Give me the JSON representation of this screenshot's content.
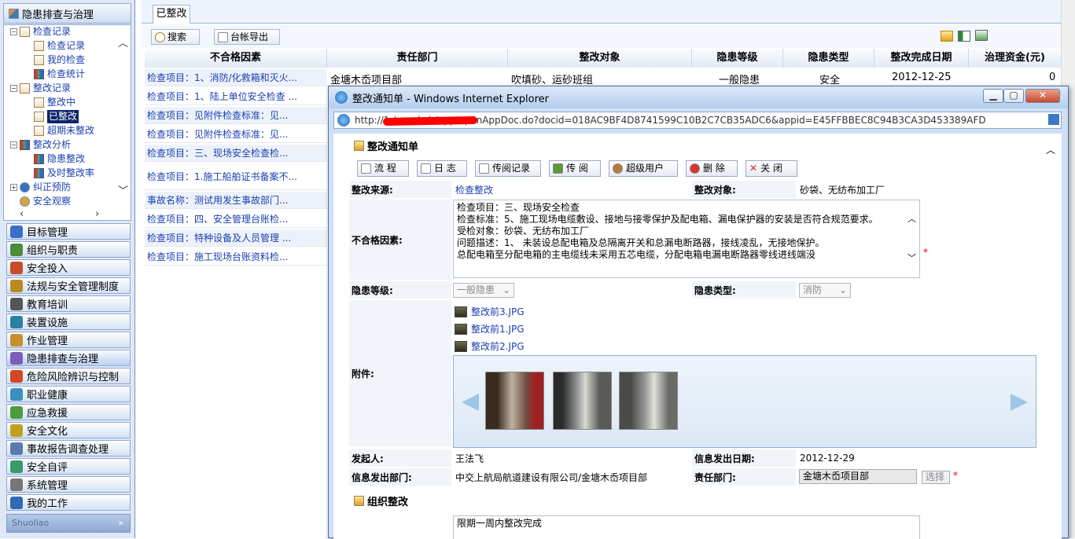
{
  "left": {
    "header": "隐患排查与治理",
    "tree": [
      {
        "label": "检查记录",
        "level": 0,
        "icon": "calendar-icon"
      },
      {
        "label": "检查记录",
        "level": 1,
        "icon": "doc-icon"
      },
      {
        "label": "我的检查",
        "level": 1,
        "icon": "doc-icon"
      },
      {
        "label": "检查统计",
        "level": 1,
        "icon": "bar-chart-icon"
      },
      {
        "label": "整改记录",
        "level": 0,
        "icon": "checklist-icon"
      },
      {
        "label": "整改中",
        "level": 1,
        "icon": "checklist-icon"
      },
      {
        "label": "已整改",
        "level": 1,
        "icon": "checklist-icon",
        "selected": true
      },
      {
        "label": "超期未整改",
        "level": 1,
        "icon": "checklist-icon"
      },
      {
        "label": "整改分析",
        "level": 0,
        "icon": "bar-chart-icon"
      },
      {
        "label": "隐患整改",
        "level": 1,
        "icon": "bar-chart-icon"
      },
      {
        "label": "及时整改率",
        "level": 1,
        "icon": "bar-chart-icon"
      },
      {
        "label": "纠正预防",
        "level": 0,
        "icon": "info-icon"
      },
      {
        "label": "安全观察",
        "level": 0,
        "icon": "user-icon"
      }
    ],
    "menus": [
      {
        "label": "目标管理",
        "color": "#3b6fc7"
      },
      {
        "label": "组织与职责",
        "color": "#4a8c3a"
      },
      {
        "label": "安全投入",
        "color": "#c94c2b"
      },
      {
        "label": "法规与安全管理制度",
        "color": "#b88a20"
      },
      {
        "label": "教育培训",
        "color": "#555555"
      },
      {
        "label": "装置设施",
        "color": "#2c7fa3"
      },
      {
        "label": "作业管理",
        "color": "#c7902b"
      },
      {
        "label": "隐患排查与治理",
        "color": "#7a5db5",
        "active": true
      },
      {
        "label": "危险风险辨识与控制",
        "color": "#d24726"
      },
      {
        "label": "职业健康",
        "color": "#3a8fbf"
      },
      {
        "label": "应急救援",
        "color": "#4d9b3a"
      },
      {
        "label": "安全文化",
        "color": "#c0a020"
      },
      {
        "label": "事故报告调查处理",
        "color": "#5a7ab0"
      },
      {
        "label": "安全自评",
        "color": "#3a9a6a"
      },
      {
        "label": "系统管理",
        "color": "#777777"
      },
      {
        "label": "我的工作",
        "color": "#2f6ab5"
      }
    ],
    "footer": "Shuoliao"
  },
  "main": {
    "tab": "已整改",
    "search_btn": "搜索",
    "export_btn": "台帐导出",
    "columns": [
      "不合格因素",
      "责任部门",
      "整改对象",
      "隐患等级",
      "隐患类型",
      "整改完成日期",
      "治理资金(元)"
    ],
    "rows": [
      {
        "factor": "检查项目：1、消防/化救箱和灭火...",
        "dept": "金塘木岙项目部",
        "object": "吹填砂、运砂班组",
        "level": "一般隐患",
        "type": "安全",
        "date": "2012-12-25",
        "fund": "0"
      },
      {
        "factor": "检查项目：1、陆上单位安全检查 ..."
      },
      {
        "factor": "检查项目：见附件检查标准：见..."
      },
      {
        "factor": "检查项目：见附件检查标准：见..."
      },
      {
        "factor": "检查项目：三、现场安全检查检..."
      },
      {
        "factor": "检查项目：1.施工船舶证书备案不..."
      },
      {
        "factor": "事故名称：测试用发生事故部门..."
      },
      {
        "factor": "检查项目：四、安全管理台账检..."
      },
      {
        "factor": "检查项目：特种设备及人员管理 ..."
      },
      {
        "factor": "检查项目：施工现场台账资料检..."
      }
    ]
  },
  "popup": {
    "title": "整改通知单 - Windows Internet Explorer",
    "url": "http://1                        /aqscbzh/app/openAppDoc.do?docid=018AC9BF4D8741599C10B2C7CB35ADC6&appid=E45FFBBEC8C94B3CA3D453389AFD",
    "doc_title": "整改通知单",
    "buttons": [
      "流 程",
      "日 志",
      "传阅记录",
      "传 阅",
      "超级用户",
      "删 除",
      "关 闭"
    ],
    "labels": {
      "source": "整改来源:",
      "object": "整改对象:",
      "factor": "不合格因素:",
      "level": "隐患等级:",
      "type": "隐患类型:",
      "attach": "附件:",
      "sender": "发起人:",
      "date": "信息发出日期:",
      "dept": "信息发出部门:",
      "resp": "责任部门:"
    },
    "values": {
      "source": "检查整改",
      "object": "砂袋、无纺布加工厂",
      "factor_lines": [
        "检查项目：三、现场安全检查",
        "检查标准：5、施工现场电缆敷设、接地与接零保护及配电箱、漏电保护器的安装是否符合规范要求。",
        "受检对象：砂袋、无纺布加工厂",
        "问题描述：1、      未装设总配电箱及总隔离开关和总漏电断路器，接线凌乱，无接地保护。",
        "    总配电箱至分配电箱的主电缆线未采用五芯电缆，分配电箱电漏电断路器零线进线端没"
      ],
      "level": "一般隐患",
      "type": "消防",
      "attachments": [
        "整改前3.JPG",
        "整改前1.JPG",
        "整改前2.JPG"
      ],
      "sender": "王法飞",
      "date": "2012-12-29",
      "dept": "中交上航局航道建设有限公司/金塘木岙项目部",
      "resp": "金塘木岙项目部",
      "choose": "选择",
      "org_section": "组织整改",
      "org_text": "限期一周内整改完成"
    }
  }
}
